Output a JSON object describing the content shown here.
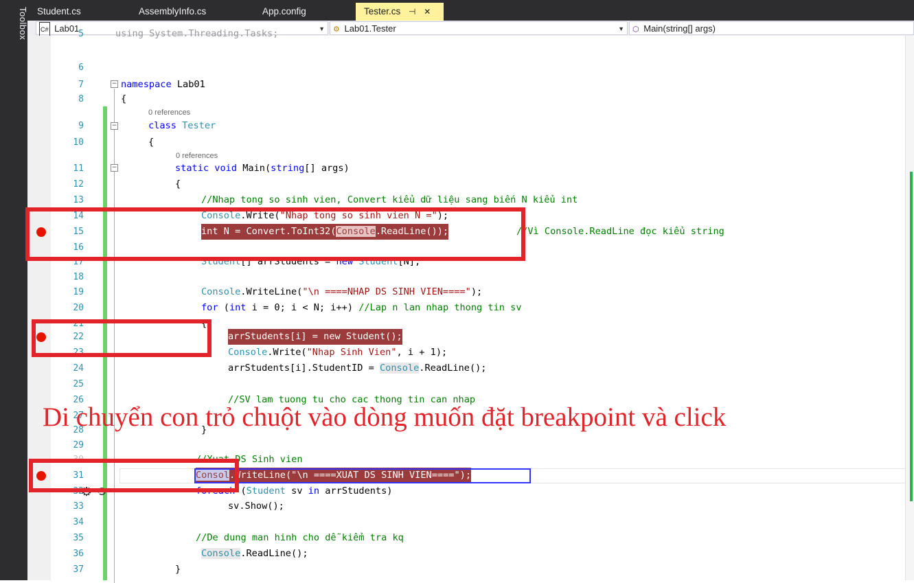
{
  "toolbox": {
    "label": "Toolbox"
  },
  "tabs": [
    {
      "label": "Student.cs",
      "active": false
    },
    {
      "label": "AssemblyInfo.cs",
      "active": false
    },
    {
      "label": "App.config",
      "active": false
    },
    {
      "label": "Tester.cs",
      "active": true
    }
  ],
  "nav": {
    "project": "Lab01",
    "class": "Lab01.Tester",
    "member": "Main(string[] args)"
  },
  "refs_label": "0 references",
  "lines": [
    {
      "n": "5",
      "text": "using System.Threading.Tasks;"
    },
    {
      "n": "6",
      "text": ""
    },
    {
      "n": "7",
      "text": "namespace Lab01"
    },
    {
      "n": "8",
      "text": "{"
    },
    {
      "n": "9",
      "text": "class Tester"
    },
    {
      "n": "10",
      "text": "{"
    },
    {
      "n": "11",
      "text": "static void Main(string[] args)"
    },
    {
      "n": "12",
      "text": "{"
    },
    {
      "n": "13",
      "text": "//Nhap tong so sinh vien, Convert kiểu dữ liệu sang biến N kiểu int"
    },
    {
      "n": "14",
      "text": "Console.Write(\"Nhap tong so sinh vien N =\");"
    },
    {
      "n": "15",
      "text": "int N = Convert.ToInt32(Console.ReadLine());"
    },
    {
      "n": "16",
      "text": ""
    },
    {
      "n": "17",
      "text": "Student[] arrStudents = new Student[N];"
    },
    {
      "n": "18",
      "text": ""
    },
    {
      "n": "19",
      "text": "Console.WriteLine(\"\\n ====NHAP DS SINH VIEN====\");"
    },
    {
      "n": "20",
      "text": "for (int i = 0; i < N; i++) //Lap n lan nhap thong tin sv"
    },
    {
      "n": "21",
      "text": "{"
    },
    {
      "n": "22",
      "text": "arrStudents[i] = new Student();"
    },
    {
      "n": "23",
      "text": "Console.Write(\"Nhap Sinh Vien\", i + 1);"
    },
    {
      "n": "24",
      "text": "arrStudents[i].StudentID = Console.ReadLine();"
    },
    {
      "n": "25",
      "text": ""
    },
    {
      "n": "26",
      "text": "//SV lam tuong tu cho cac thong tin can nhap"
    },
    {
      "n": "27",
      "text": ""
    },
    {
      "n": "28",
      "text": "}"
    },
    {
      "n": "29",
      "text": ""
    },
    {
      "n": "30",
      "text": "//Xuat DS Sinh vien"
    },
    {
      "n": "31",
      "text": "Console.WriteLine(\"\\n ====XUAT DS SINH VIEN====\");"
    },
    {
      "n": "32",
      "text": "foreach (Student sv in arrStudents)"
    },
    {
      "n": "33",
      "text": "sv.Show();"
    },
    {
      "n": "34",
      "text": ""
    },
    {
      "n": "35",
      "text": "//De dung man hinh cho dễ kiểm tra kq"
    },
    {
      "n": "36",
      "text": "Console.ReadLine();"
    },
    {
      "n": "37",
      "text": "}"
    }
  ],
  "line15_comment": "//Vì Console.ReadLine đọc kiểu string",
  "caption": "Di chuyển con trỏ chuột vào dòng muốn đặt breakpoint và click",
  "colors": {
    "breakpoint": "#e51400",
    "breakpoint_highlight": "#9b3b3b",
    "annotation": "#e2232a",
    "line_number": "#2b91af",
    "keyword": "#0000ff",
    "comment": "#008000",
    "string": "#a31515",
    "change_bar": "#6bd36b"
  }
}
